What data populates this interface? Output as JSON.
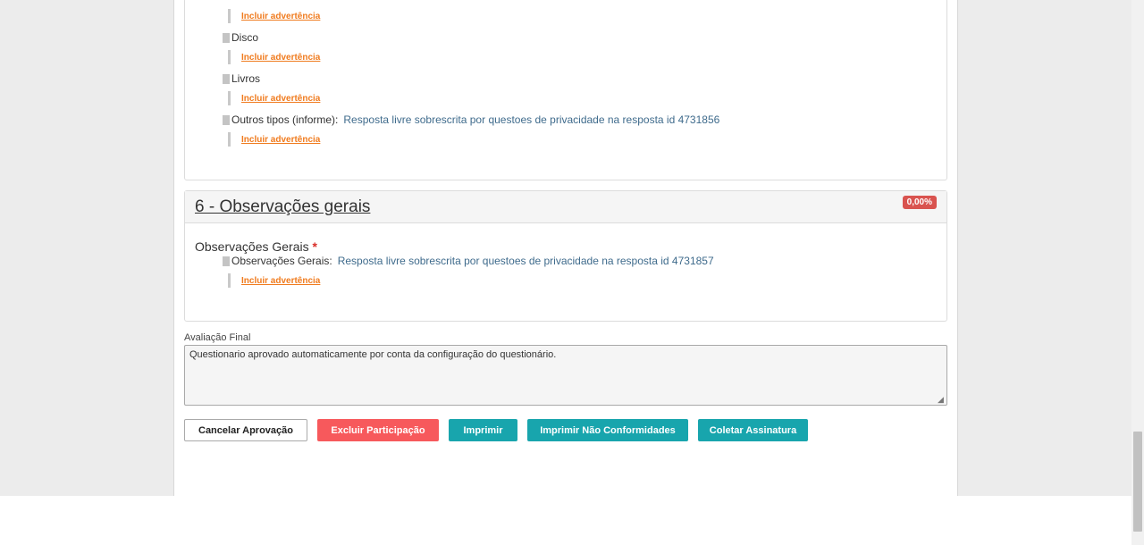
{
  "section5": {
    "items": [
      {
        "label": "Disco",
        "answer": ""
      },
      {
        "label": "Livros",
        "answer": ""
      },
      {
        "label": "Outros tipos (informe):",
        "answer": "Resposta livre sobrescrita por questoes de privacidade na resposta id 4731856"
      }
    ],
    "warning_link": "Incluir advertência"
  },
  "section6": {
    "title": "6 - Observações gerais",
    "score_badge": "0,00%",
    "question_title": "Observações Gerais",
    "required_mark": "*",
    "item_label": "Observações Gerais:",
    "item_answer": "Resposta livre sobrescrita por questoes de privacidade na resposta id 4731857",
    "warning_link": "Incluir advertência"
  },
  "final_evaluation": {
    "label": "Avaliação Final",
    "value": "Questionario aprovado automaticamente por conta da configuração do questionário."
  },
  "buttons": {
    "cancel": "Cancelar Aprovação",
    "delete": "Excluir Participação",
    "print": "Imprimir",
    "print_nc": "Imprimir Não Conformidades",
    "sign": "Coletar Assinatura"
  },
  "colors": {
    "danger": "#f7595c",
    "info": "#18a5ad",
    "link": "#f07b1e",
    "answer": "#3f6b8c"
  }
}
